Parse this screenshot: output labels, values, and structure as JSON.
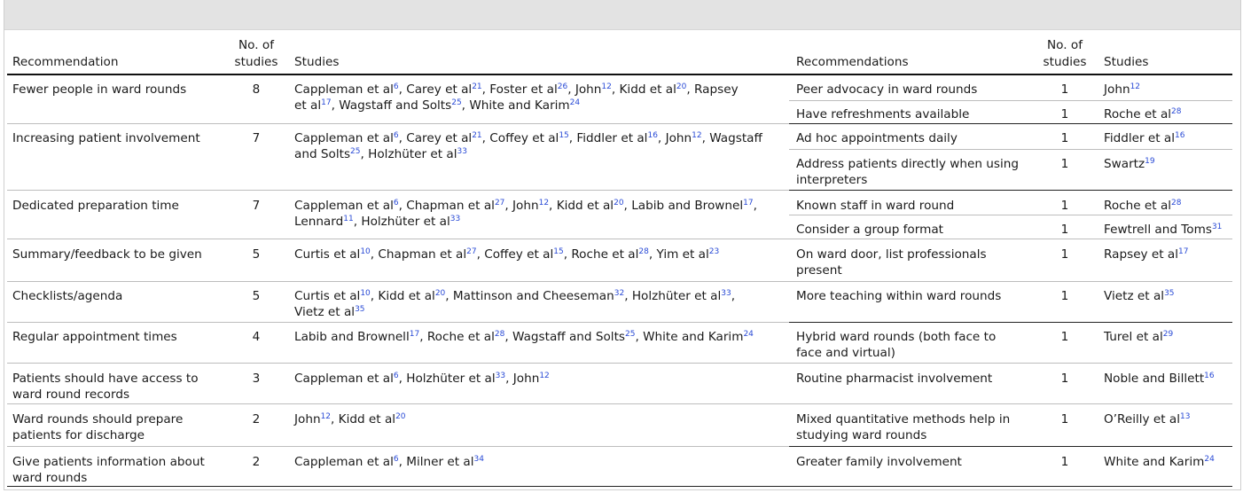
{
  "headers": {
    "left": {
      "recommendation": "Recommendation",
      "count_line1": "No. of",
      "count_line2": "studies",
      "studies": "Studies"
    },
    "right": {
      "recommendation": "Recommendations",
      "count_line1": "No. of",
      "count_line2": "studies",
      "studies": "Studies"
    }
  },
  "left_rows": [
    {
      "recommendation": [
        "Fewer people in ward rounds"
      ],
      "count": "8",
      "studies": [
        [
          [
            "Cappleman et al",
            "6"
          ],
          ", Carey et al",
          [
            "",
            "21"
          ],
          ", Foster et al",
          [
            "",
            "26"
          ],
          ", John",
          [
            "",
            "12"
          ],
          ", Kidd et al",
          [
            "",
            "20"
          ],
          ", Rapsey"
        ],
        [
          [
            "et al",
            "17"
          ],
          ", Wagstaff and Solts",
          [
            "",
            "25"
          ],
          ", White and Karim",
          [
            "",
            "24"
          ]
        ]
      ]
    },
    {
      "recommendation": [
        "Increasing patient involvement"
      ],
      "count": "7",
      "studies": [
        [
          [
            "Cappleman et al",
            "6"
          ],
          ", Carey et al",
          [
            "",
            "21"
          ],
          ", Coffey et al",
          [
            "",
            "15"
          ],
          ", Fiddler et al",
          [
            "",
            "16"
          ],
          ", John",
          [
            "",
            "12"
          ],
          ", Wagstaff"
        ],
        [
          [
            "and Solts",
            "25"
          ],
          ", Holzhüter et al",
          [
            "",
            "33"
          ]
        ]
      ]
    },
    {
      "recommendation": [
        "Dedicated preparation time"
      ],
      "count": "7",
      "studies": [
        [
          [
            "Cappleman et al",
            "6"
          ],
          ", Chapman et al",
          [
            "",
            "27"
          ],
          ", John",
          [
            "",
            "12"
          ],
          ", Kidd et al",
          [
            "",
            "20"
          ],
          ", Labib and Brownel",
          [
            "",
            "17"
          ],
          ","
        ],
        [
          [
            "Lennard",
            "11"
          ],
          ", Holzhüter et al",
          [
            "",
            "33"
          ]
        ]
      ]
    },
    {
      "recommendation": [
        "Summary/feedback to be given"
      ],
      "count": "5",
      "studies": [
        [
          [
            "Curtis et al",
            "10"
          ],
          ", Chapman et al",
          [
            "",
            "27"
          ],
          ", Coffey et al",
          [
            "",
            "15"
          ],
          ", Roche et al",
          [
            "",
            "28"
          ],
          ", Yim et al",
          [
            "",
            "23"
          ]
        ]
      ]
    },
    {
      "recommendation": [
        "Checklists/agenda"
      ],
      "count": "5",
      "studies": [
        [
          [
            "Curtis et al",
            "10"
          ],
          ", Kidd et al",
          [
            "",
            "20"
          ],
          ", Mattinson and Cheeseman",
          [
            "",
            "32"
          ],
          ", Holzhüter et al",
          [
            "",
            "33"
          ],
          ","
        ],
        [
          [
            "Vietz et al",
            "35"
          ]
        ]
      ]
    },
    {
      "recommendation": [
        "Regular appointment times"
      ],
      "count": "4",
      "studies": [
        [
          [
            "Labib and Brownell",
            "17"
          ],
          ", Roche et al",
          [
            "",
            "28"
          ],
          ", Wagstaff and Solts",
          [
            "",
            "25"
          ],
          ", White and Karim",
          [
            "",
            "24"
          ]
        ]
      ]
    },
    {
      "recommendation": [
        "Patients should have access to",
        "ward round records"
      ],
      "count": "3",
      "studies": [
        [
          [
            "Cappleman et al",
            "6"
          ],
          ", Holzhüter et al",
          [
            "",
            "33"
          ],
          ", John",
          [
            "",
            "12"
          ]
        ]
      ]
    },
    {
      "recommendation": [
        "Ward rounds should prepare",
        "patients for discharge"
      ],
      "count": "2",
      "studies": [
        [
          [
            "John",
            "12"
          ],
          ", Kidd et al",
          [
            "",
            "20"
          ]
        ]
      ]
    },
    {
      "recommendation": [
        "Give patients information about",
        "ward rounds"
      ],
      "count": "2",
      "studies": [
        [
          [
            "Cappleman et al",
            "6"
          ],
          ", Milner et al",
          [
            "",
            "34"
          ]
        ]
      ]
    }
  ],
  "right_rows": [
    {
      "recommendation": [
        "Peer advocacy in ward rounds"
      ],
      "count": "1",
      "study": [
        "John",
        "12"
      ]
    },
    {
      "recommendation": [
        "Have refreshments available"
      ],
      "count": "1",
      "study": [
        "Roche et al",
        "28"
      ]
    },
    {
      "recommendation": [
        "Ad hoc appointments daily"
      ],
      "count": "1",
      "study": [
        "Fiddler et al",
        "16"
      ]
    },
    {
      "recommendation": [
        "Address patients directly when using",
        "interpreters"
      ],
      "count": "1",
      "study": [
        "Swartz",
        "19"
      ]
    },
    {
      "recommendation": [
        "Known staff in ward round"
      ],
      "count": "1",
      "study": [
        "Roche et al",
        "28"
      ]
    },
    {
      "recommendation": [
        "Consider a group format"
      ],
      "count": "1",
      "study": [
        "Fewtrell and Toms",
        "31"
      ]
    },
    {
      "recommendation": [
        "On ward door, list professionals",
        "present"
      ],
      "count": "1",
      "study": [
        "Rapsey et al",
        "17"
      ]
    },
    {
      "recommendation": [
        "More teaching within ward rounds"
      ],
      "count": "1",
      "study": [
        "Vietz et al",
        "35"
      ]
    },
    {
      "recommendation": [
        "Hybrid ward rounds (both face to",
        "face and virtual)"
      ],
      "count": "1",
      "study": [
        "Turel et al",
        "29"
      ]
    },
    {
      "recommendation": [
        "Routine pharmacist involvement"
      ],
      "count": "1",
      "study": [
        "Noble and Billett",
        "16"
      ]
    },
    {
      "recommendation": [
        "Mixed quantitative methods help in",
        "studying ward rounds"
      ],
      "count": "1",
      "study": [
        "O’Reilly et al",
        "13"
      ]
    },
    {
      "recommendation": [
        "Greater family involvement"
      ],
      "count": "1",
      "study": [
        "White and Karim",
        "24"
      ]
    }
  ]
}
